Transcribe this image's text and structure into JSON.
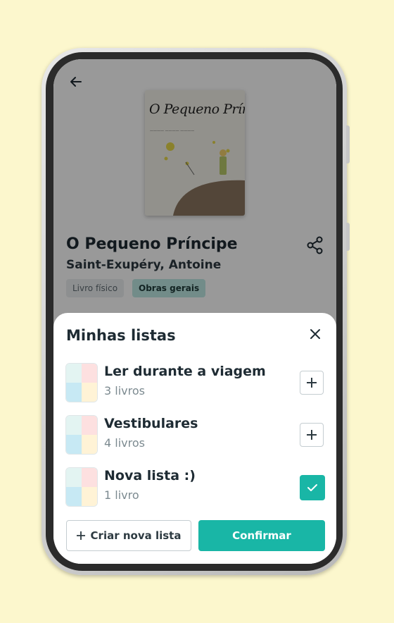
{
  "book": {
    "cover_title": "O Pequeno Príncipe",
    "title": "O Pequeno Príncipe",
    "author": "Saint-Exupéry, Antoine",
    "tags": [
      "Livro físico",
      "Obras gerais"
    ]
  },
  "sheet": {
    "title": "Minhas listas",
    "lists": [
      {
        "name": "Ler durante a viagem",
        "count": "3 livros",
        "selected": false
      },
      {
        "name": "Vestibulares",
        "count": "4 livros",
        "selected": false
      },
      {
        "name": "Nova lista :)",
        "count": "1 livro",
        "selected": true
      }
    ],
    "create_label": "Criar nova lista",
    "confirm_label": "Confirmar"
  },
  "colors": {
    "background": "#fcf7cd",
    "accent": "#19b6a6",
    "tag_highlight": "#bfe9e5"
  }
}
